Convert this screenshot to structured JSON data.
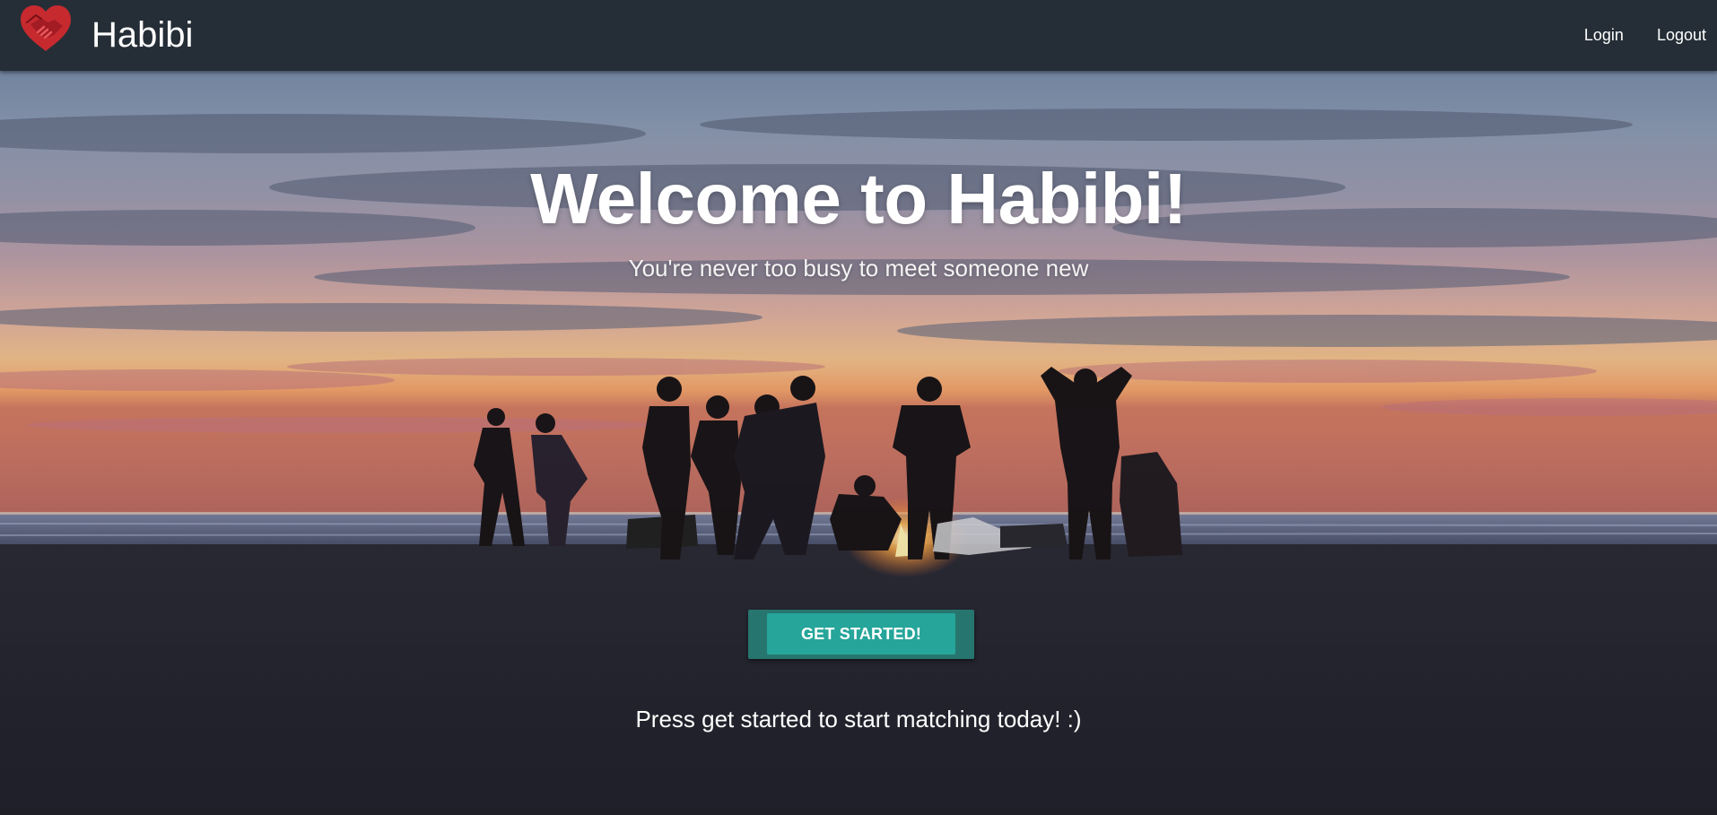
{
  "navbar": {
    "logo_icon": "heart-handshake-icon",
    "brand": "Habibi",
    "links": [
      {
        "label": "Login"
      },
      {
        "label": "Logout"
      }
    ],
    "background_color": "#252e36"
  },
  "hero": {
    "title": "Welcome to Habibi!",
    "subtitle": "You're never too busy to meet someone new",
    "cta_label": "GET STARTED!",
    "note": "Press get started to start matching today! :)",
    "background_image": "friends-around-beach-bonfire-at-sunset",
    "accent_color": "#26a59a"
  }
}
